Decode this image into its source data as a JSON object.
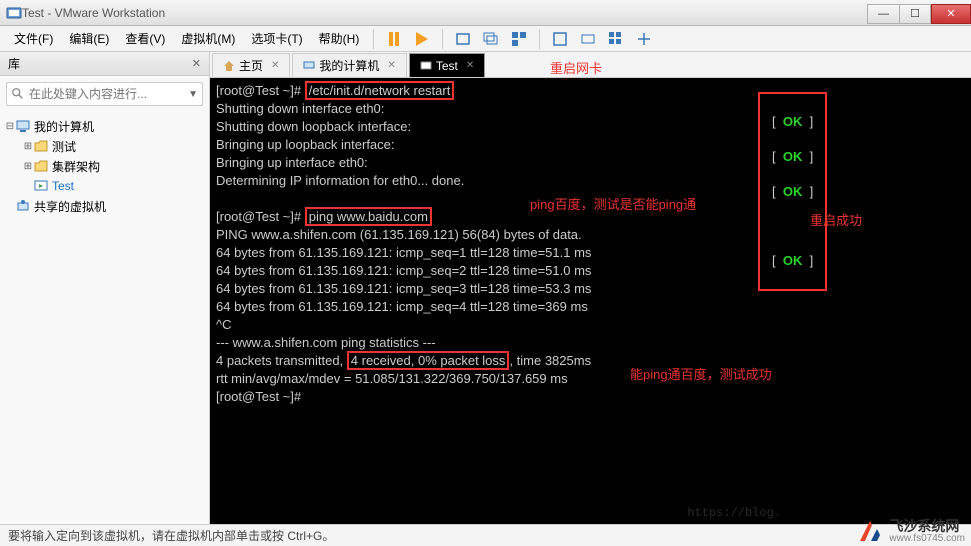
{
  "window": {
    "title": "Test - VMware Workstation"
  },
  "winbtns": {
    "min": "—",
    "max": "☐",
    "close": "✕"
  },
  "menu": {
    "file": "文件(F)",
    "edit": "编辑(E)",
    "view": "查看(V)",
    "vm": "虚拟机(M)",
    "tabs": "选项卡(T)",
    "help": "帮助(H)"
  },
  "sidebar": {
    "header": "库",
    "close": "✕",
    "search_placeholder": "在此处键入内容进行...",
    "nodes": {
      "root": "我的计算机",
      "n1": "测试",
      "n2": "集群架构",
      "n3": "Test",
      "shared": "共享的虚拟机"
    }
  },
  "tabstrip": {
    "home": "主页",
    "mycomputer": "我的计算机",
    "test": "Test"
  },
  "terminal": {
    "l0_prompt": "[root@Test ~]# ",
    "l0_cmd": "/etc/init.d/network restart",
    "l1": "Shutting down interface eth0:",
    "l2": "Shutting down loopback interface:",
    "l3": "Bringing up loopback interface:",
    "l4": "Bringing up interface eth0:",
    "l5": "Determining IP information for eth0... done.",
    "l6": "",
    "l7_prompt": "[root@Test ~]# ",
    "l7_cmd": "ping www.baidu.com",
    "l8": "PING www.a.shifen.com (61.135.169.121) 56(84) bytes of data.",
    "l9": "64 bytes from 61.135.169.121: icmp_seq=1 ttl=128 time=51.1 ms",
    "l10": "64 bytes from 61.135.169.121: icmp_seq=2 ttl=128 time=51.0 ms",
    "l11": "64 bytes from 61.135.169.121: icmp_seq=3 ttl=128 time=53.3 ms",
    "l12": "64 bytes from 61.135.169.121: icmp_seq=4 ttl=128 time=369 ms",
    "l13": "^C",
    "l14": "--- www.a.shifen.com ping statistics ---",
    "l15a": "4 packets transmitted, ",
    "l15b": "4 received, 0% packet loss",
    "l15c": ", time 3825ms",
    "l16": "rtt min/avg/max/mdev = 51.085/131.322/369.750/137.659 ms",
    "l17": "[root@Test ~]# ",
    "ok": "OK",
    "bracket_l": "[  ",
    "bracket_r": "  ]"
  },
  "annotations": {
    "a1": "重启网卡",
    "a2": "ping百度，测试是否能ping通",
    "a3": "重启成功",
    "a4": "能ping通百度，测试成功"
  },
  "statusbar": {
    "text": "要将输入定向到该虚拟机，请在虚拟机内部单击或按 Ctrl+G。"
  },
  "watermark": {
    "name": "飞沙系统网",
    "url": "www.fs0745.com",
    "blog": "https://blog."
  }
}
